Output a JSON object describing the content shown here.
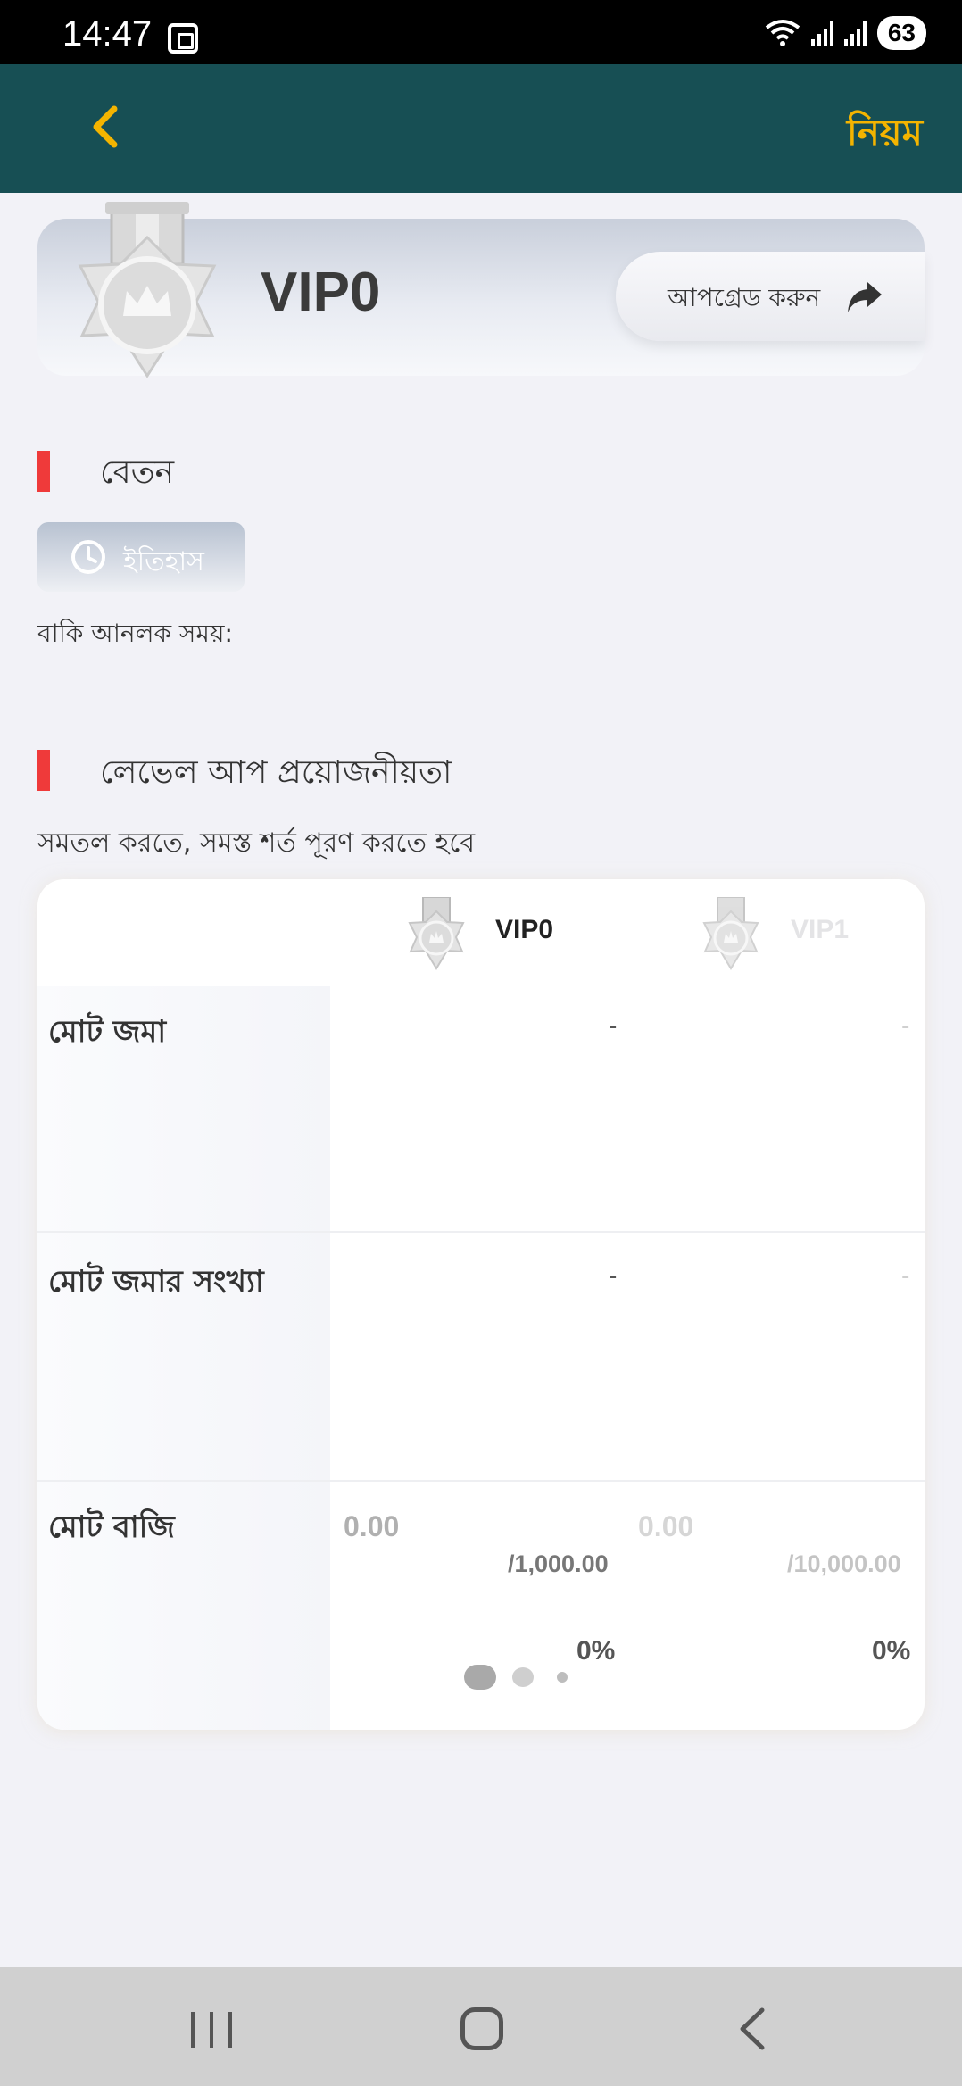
{
  "status_bar": {
    "time": "14:47",
    "battery": "63"
  },
  "header": {
    "rules_label": "নিয়ম"
  },
  "vip_card": {
    "level_name": "VIP0",
    "upgrade_label": "আপগ্রেড করুন"
  },
  "salary_section": {
    "title": "বেতন",
    "history_label": "ইতিহাস",
    "remaining_time_label": "বাকি আনলক সময়:"
  },
  "levelup_section": {
    "title": "লেভেল আপ প্রয়োজনীয়তা",
    "subtitle": "সমতল করতে, সমস্ত শর্ত পূরণ করতে হবে"
  },
  "requirements_table": {
    "columns": [
      {
        "level": "VIP0",
        "active": true
      },
      {
        "level": "VIP1",
        "active": false
      }
    ],
    "rows": [
      {
        "label": "মোট জমা",
        "values": [
          "-",
          "-"
        ]
      },
      {
        "label": "মোট জমার সংখ্যা",
        "values": [
          "-",
          "-"
        ]
      },
      {
        "label": "মোট বাজি",
        "current": [
          "0.00",
          "0.00"
        ],
        "target": [
          "/1,000.00",
          "/10,000.00"
        ],
        "percent": [
          "0%",
          "0%"
        ]
      }
    ],
    "pager": {
      "pages": 3,
      "active_index": 0
    }
  },
  "colors": {
    "header_bg": "#174f54",
    "accent_gold": "#f4b400",
    "section_bar": "#ef3a3a",
    "page_bg": "#f2f2f7"
  },
  "icons": [
    "back-chevron-icon",
    "share-arrow-icon",
    "history-clock-icon",
    "medal-icon",
    "wifi-icon",
    "signal-icon",
    "screenshot-icon"
  ]
}
